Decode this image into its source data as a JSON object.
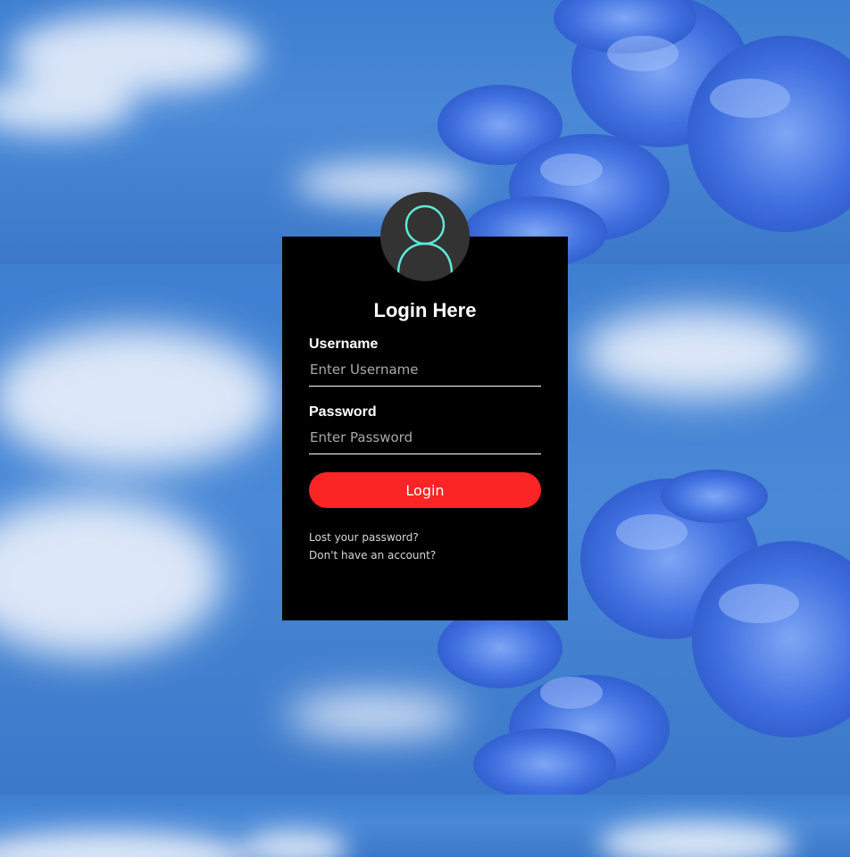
{
  "colors": {
    "box_background": "#000000",
    "avatar_background": "#333333",
    "avatar_stroke": "#5fe8d6",
    "button_background": "#fb2525",
    "text": "#ffffff",
    "link_text": "#d6d6d6",
    "placeholder": "#a8a8a8"
  },
  "avatar": {
    "icon": "user-icon"
  },
  "form": {
    "title": "Login Here",
    "username": {
      "label": "Username",
      "placeholder": "Enter Username",
      "value": ""
    },
    "password": {
      "label": "Password",
      "placeholder": "Enter Password",
      "value": ""
    },
    "submit_label": "Login",
    "lost_password_link": "Lost your password?",
    "signup_link": "Don't have an account?"
  }
}
